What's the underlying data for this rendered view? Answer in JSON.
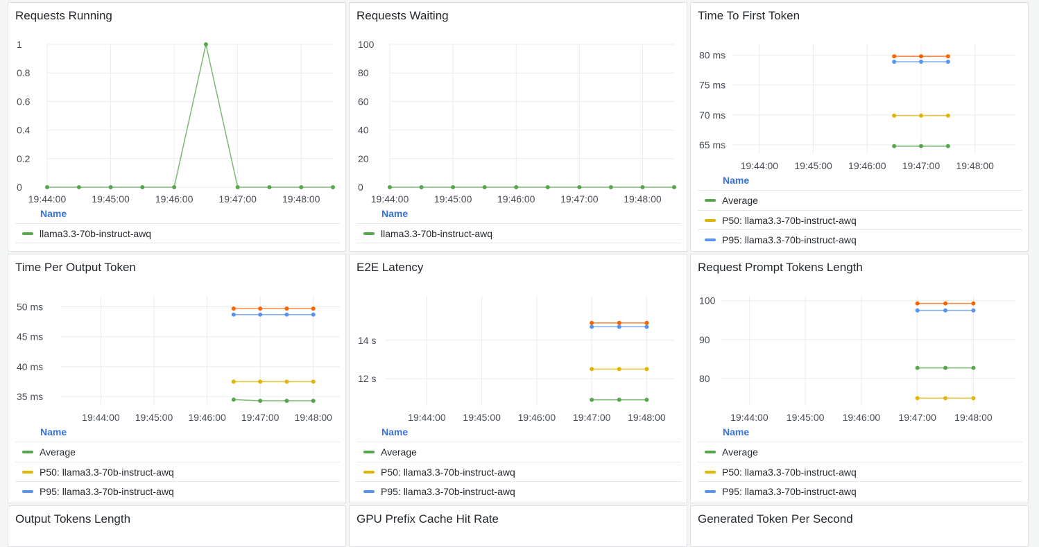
{
  "dashboard": {
    "panels": [
      {
        "id": "requests-running",
        "title": "Requests Running",
        "legend_header": "Name",
        "legend": [
          {
            "label": "llama3.3-70b-instruct-awq",
            "color": "#56a64b"
          }
        ],
        "chart_data": {
          "type": "line",
          "x_ticks": [
            "19:44:00",
            "19:45:00",
            "19:46:00",
            "19:47:00",
            "19:48:00"
          ],
          "y_ticks": [
            "0",
            "0.2",
            "0.4",
            "0.6",
            "0.8",
            "1"
          ],
          "ylim": [
            0,
            1
          ],
          "x_range": [
            "19:44:00",
            "19:48:30"
          ],
          "series": [
            {
              "name": "llama3.3-70b-instruct-awq",
              "color": "#56a64b",
              "x": [
                "19:44:00",
                "19:44:30",
                "19:45:00",
                "19:45:30",
                "19:46:00",
                "19:46:30",
                "19:47:00",
                "19:47:30",
                "19:48:00",
                "19:48:30"
              ],
              "y": [
                0,
                0,
                0,
                0,
                0,
                1,
                0,
                0,
                0,
                0
              ]
            }
          ]
        }
      },
      {
        "id": "requests-waiting",
        "title": "Requests Waiting",
        "legend_header": "Name",
        "legend": [
          {
            "label": "llama3.3-70b-instruct-awq",
            "color": "#56a64b"
          }
        ],
        "chart_data": {
          "type": "line",
          "x_ticks": [
            "19:44:00",
            "19:45:00",
            "19:46:00",
            "19:47:00",
            "19:48:00"
          ],
          "y_ticks": [
            "0",
            "20",
            "40",
            "60",
            "80",
            "100"
          ],
          "ylim": [
            0,
            100
          ],
          "x_range": [
            "19:44:00",
            "19:48:30"
          ],
          "series": [
            {
              "name": "llama3.3-70b-instruct-awq",
              "color": "#56a64b",
              "x": [
                "19:44:00",
                "19:44:30",
                "19:45:00",
                "19:45:30",
                "19:46:00",
                "19:46:30",
                "19:47:00",
                "19:47:30",
                "19:48:00",
                "19:48:30"
              ],
              "y": [
                0,
                0,
                0,
                0,
                0,
                0,
                0,
                0,
                0,
                0
              ]
            }
          ]
        }
      },
      {
        "id": "time-to-first-token",
        "title": "Time To First Token",
        "legend_header": "Name",
        "legend": [
          {
            "label": "Average",
            "color": "#56a64b"
          },
          {
            "label": "P50: llama3.3-70b-instruct-awq",
            "color": "#e0b400"
          },
          {
            "label": "P95: llama3.3-70b-instruct-awq",
            "color": "#5794f2"
          }
        ],
        "chart_data": {
          "type": "line",
          "x_ticks": [
            "19:44:00",
            "19:45:00",
            "19:46:00",
            "19:47:00",
            "19:48:00"
          ],
          "y_ticks": [
            "65 ms",
            "70 ms",
            "75 ms",
            "80 ms"
          ],
          "y_tick_values": [
            65,
            70,
            75,
            80
          ],
          "ylim": [
            63.5,
            81.8
          ],
          "x_range": [
            "19:43:30",
            "19:48:45"
          ],
          "series": [
            {
              "name": "Average",
              "color": "#56a64b",
              "x": [
                "19:46:30",
                "19:47:00",
                "19:47:30"
              ],
              "y": [
                64.8,
                64.8,
                64.8
              ]
            },
            {
              "name": "P50: llama3.3-70b-instruct-awq",
              "color": "#e0b400",
              "x": [
                "19:46:30",
                "19:47:00",
                "19:47:30"
              ],
              "y": [
                69.9,
                69.9,
                69.9
              ]
            },
            {
              "name": "P95: llama3.3-70b-instruct-awq",
              "color": "#5794f2",
              "x": [
                "19:46:30",
                "19:47:00",
                "19:47:30"
              ],
              "y": [
                78.9,
                78.9,
                78.9
              ]
            },
            {
              "color": "#fa6400",
              "x": [
                "19:46:30",
                "19:47:00",
                "19:47:30"
              ],
              "y": [
                79.8,
                79.8,
                79.8
              ]
            }
          ]
        }
      },
      {
        "id": "time-per-output-token",
        "title": "Time Per Output Token",
        "legend_header": "Name",
        "legend": [
          {
            "label": "Average",
            "color": "#56a64b"
          },
          {
            "label": "P50: llama3.3-70b-instruct-awq",
            "color": "#e0b400"
          },
          {
            "label": "P95: llama3.3-70b-instruct-awq",
            "color": "#5794f2"
          }
        ],
        "chart_data": {
          "type": "line",
          "x_ticks": [
            "19:44:00",
            "19:45:00",
            "19:46:00",
            "19:47:00",
            "19:48:00"
          ],
          "y_ticks": [
            "35 ms",
            "40 ms",
            "45 ms",
            "50 ms"
          ],
          "y_tick_values": [
            35,
            40,
            45,
            50
          ],
          "ylim": [
            33.5,
            51.8
          ],
          "x_range": [
            "19:43:15",
            "19:48:30"
          ],
          "series": [
            {
              "name": "Average",
              "color": "#56a64b",
              "x": [
                "19:46:30",
                "19:47:00",
                "19:47:30",
                "19:48:00"
              ],
              "y": [
                34.5,
                34.3,
                34.3,
                34.3
              ]
            },
            {
              "name": "P50: llama3.3-70b-instruct-awq",
              "color": "#e0b400",
              "x": [
                "19:46:30",
                "19:47:00",
                "19:47:30",
                "19:48:00"
              ],
              "y": [
                37.5,
                37.5,
                37.5,
                37.5
              ]
            },
            {
              "name": "P95: llama3.3-70b-instruct-awq",
              "color": "#5794f2",
              "x": [
                "19:46:30",
                "19:47:00",
                "19:47:30",
                "19:48:00"
              ],
              "y": [
                48.7,
                48.7,
                48.7,
                48.7
              ]
            },
            {
              "color": "#fa6400",
              "x": [
                "19:46:30",
                "19:47:00",
                "19:47:30",
                "19:48:00"
              ],
              "y": [
                49.7,
                49.7,
                49.7,
                49.7
              ]
            }
          ]
        }
      },
      {
        "id": "e2e-latency",
        "title": "E2E Latency",
        "legend_header": "Name",
        "legend": [
          {
            "label": "Average",
            "color": "#56a64b"
          },
          {
            "label": "P50: llama3.3-70b-instruct-awq",
            "color": "#e0b400"
          },
          {
            "label": "P95: llama3.3-70b-instruct-awq",
            "color": "#5794f2"
          }
        ],
        "chart_data": {
          "type": "line",
          "x_ticks": [
            "19:44:00",
            "19:45:00",
            "19:46:00",
            "19:47:00",
            "19:48:00"
          ],
          "y_ticks": [
            "12 s",
            "14 s"
          ],
          "y_tick_values": [
            12,
            14
          ],
          "ylim": [
            10.6,
            16.3
          ],
          "x_range": [
            "19:43:15",
            "19:48:30"
          ],
          "series": [
            {
              "name": "Average",
              "color": "#56a64b",
              "x": [
                "19:47:00",
                "19:47:30",
                "19:48:00"
              ],
              "y": [
                10.9,
                10.9,
                10.9
              ]
            },
            {
              "name": "P50: llama3.3-70b-instruct-awq",
              "color": "#e0b400",
              "x": [
                "19:47:00",
                "19:47:30",
                "19:48:00"
              ],
              "y": [
                12.5,
                12.5,
                12.5
              ]
            },
            {
              "name": "P95: llama3.3-70b-instruct-awq",
              "color": "#5794f2",
              "x": [
                "19:47:00",
                "19:47:30",
                "19:48:00"
              ],
              "y": [
                14.7,
                14.7,
                14.7
              ]
            },
            {
              "color": "#fa6400",
              "x": [
                "19:47:00",
                "19:47:30",
                "19:48:00"
              ],
              "y": [
                14.9,
                14.9,
                14.9
              ]
            }
          ]
        }
      },
      {
        "id": "request-prompt-tokens-length",
        "title": "Request Prompt Tokens Length",
        "legend_header": "Name",
        "legend": [
          {
            "label": "Average",
            "color": "#56a64b"
          },
          {
            "label": "P50: llama3.3-70b-instruct-awq",
            "color": "#e0b400"
          },
          {
            "label": "P95: llama3.3-70b-instruct-awq",
            "color": "#5794f2"
          }
        ],
        "chart_data": {
          "type": "line",
          "x_ticks": [
            "19:44:00",
            "19:45:00",
            "19:46:00",
            "19:47:00",
            "19:48:00"
          ],
          "y_ticks": [
            "80",
            "90",
            "100"
          ],
          "y_tick_values": [
            80,
            90,
            100
          ],
          "ylim": [
            73,
            101.2
          ],
          "x_range": [
            "19:43:30",
            "19:48:45"
          ],
          "series": [
            {
              "name": "Average",
              "color": "#56a64b",
              "x": [
                "19:47:00",
                "19:47:30",
                "19:48:00"
              ],
              "y": [
                82.7,
                82.7,
                82.7
              ]
            },
            {
              "name": "P50: llama3.3-70b-instruct-awq",
              "color": "#e0b400",
              "x": [
                "19:47:00",
                "19:47:30",
                "19:48:00"
              ],
              "y": [
                74.9,
                74.9,
                74.9
              ]
            },
            {
              "name": "P95: llama3.3-70b-instruct-awq",
              "color": "#5794f2",
              "x": [
                "19:47:00",
                "19:47:30",
                "19:48:00"
              ],
              "y": [
                97.5,
                97.5,
                97.5
              ]
            },
            {
              "color": "#fa6400",
              "x": [
                "19:47:00",
                "19:47:30",
                "19:48:00"
              ],
              "y": [
                99.3,
                99.3,
                99.3
              ]
            }
          ]
        }
      }
    ],
    "bottom_panels": [
      {
        "id": "output-tokens-length",
        "title": "Output Tokens Length"
      },
      {
        "id": "gpu-prefix-cache-hit-rate",
        "title": "GPU Prefix Cache Hit Rate"
      },
      {
        "id": "generated-token-per-second",
        "title": "Generated Token Per Second"
      }
    ]
  }
}
